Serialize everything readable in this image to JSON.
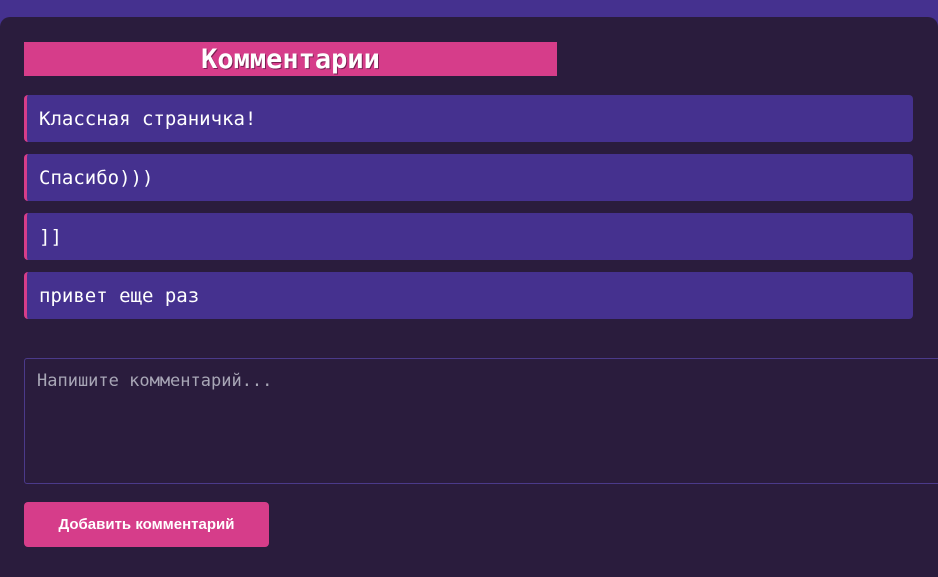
{
  "comments_section": {
    "title": "Комментарии",
    "comments": [
      {
        "text": "Классная страничка!"
      },
      {
        "text": "Спасибо)))"
      },
      {
        "text": "]]"
      },
      {
        "text": "привет еще раз"
      }
    ],
    "input": {
      "placeholder": "Напишите комментарий...",
      "value": ""
    },
    "submit_label": "Добавить комментарий"
  },
  "colors": {
    "page_background": "#45318f",
    "panel_background": "#2a1c3d",
    "accent": "#d63d8a",
    "comment_background": "#45318f"
  }
}
